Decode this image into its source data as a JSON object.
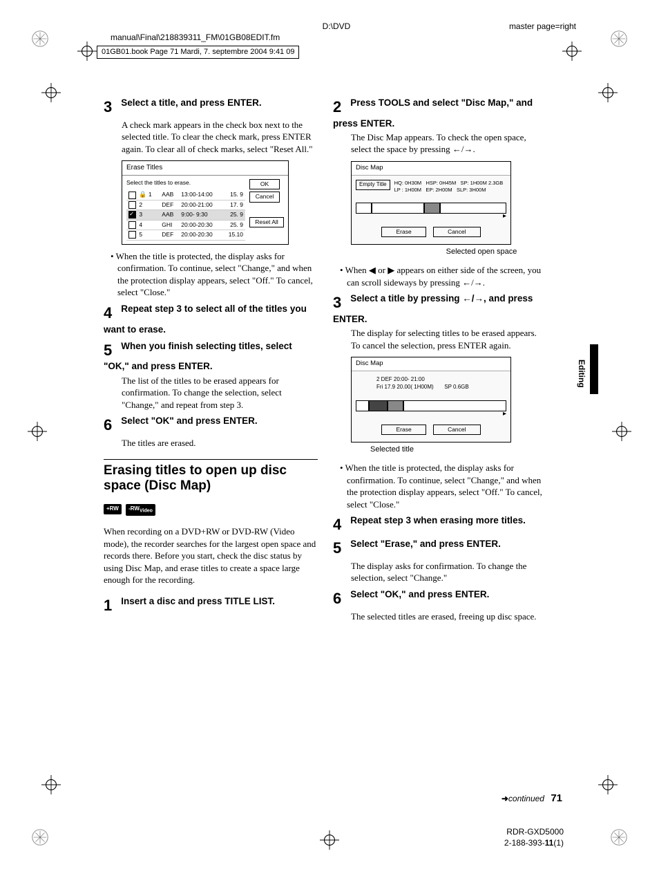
{
  "header": {
    "path1": "D:\\DVD",
    "path2": "manual\\Final\\218839311_FM\\01GB08EDIT.fm",
    "master": "master page=right",
    "book": "01GB01.book  Page 71  Mardi, 7. septembre 2004  9:41 09"
  },
  "left": {
    "s3_head": "Select a title, and press ENTER.",
    "s3_body": "A check mark appears in the check box next to the selected title. To clear the check mark, press ENTER again. To clear all of check marks, select \"Reset All.\"",
    "erase_panel": {
      "title": "Erase Titles",
      "instr": "Select the titles to erase.",
      "btn_ok": "OK",
      "btn_cancel": "Cancel",
      "btn_reset": "Reset All",
      "rows": [
        {
          "n": "1",
          "name": "AAB",
          "time": "13:00-14:00",
          "d": "15. 9",
          "lock": true,
          "checked": false
        },
        {
          "n": "2",
          "name": "DEF",
          "time": "20:00-21:00",
          "d": "17. 9",
          "lock": false,
          "checked": false
        },
        {
          "n": "3",
          "name": "AAB",
          "time": "9:00- 9:30",
          "d": "25. 9",
          "lock": false,
          "checked": true
        },
        {
          "n": "4",
          "name": "GHI",
          "time": "20:00-20:30",
          "d": "25. 9",
          "lock": false,
          "checked": false
        },
        {
          "n": "5",
          "name": "DEF",
          "time": "20:00-20:30",
          "d": "15.10",
          "lock": false,
          "checked": false
        }
      ]
    },
    "s3_note": "When the title is protected, the display asks for confirmation. To continue, select \"Change,\" and when the protection display appears, select \"Off.\" To cancel, select \"Close.\"",
    "s4_head": "Repeat step 3 to select all of the titles you want to erase.",
    "s5_head": "When you finish selecting titles, select \"OK,\" and press ENTER.",
    "s5_body": "The list of the titles to be erased appears for confirmation. To change the selection, select \"Change,\" and repeat from step 3.",
    "s6_head": "Select \"OK\" and press ENTER.",
    "s6_body": "The titles are erased.",
    "section": "Erasing titles to open up disc space (Disc Map)",
    "badges": {
      "a": "+RW",
      "b": "-RW",
      "bvideo": "Video"
    },
    "intro": "When recording on a DVD+RW or DVD-RW (Video mode), the recorder searches for the largest open space and records there. Before you start, check the disc status by using Disc Map, and erase titles to create a space large enough for the recording.",
    "s1_head": "Insert a disc and press TITLE LIST."
  },
  "right": {
    "s2_head": "Press TOOLS and select \"Disc Map,\" and press ENTER.",
    "s2_body": "The Disc Map appears. To check the open space, select the space by pressing ←/→.",
    "dm1": {
      "title": "Disc Map",
      "empty": "Empty Title",
      "l1": "HQ: 0H30M",
      "l2": "LP : 1H00M",
      "l3": "HSP: 0H45M",
      "l4": "EP: 2H00M",
      "l5": "SP: 1H00M",
      "l6": "SLP: 3H00M",
      "size": "2.3GB",
      "erase": "Erase",
      "cancel": "Cancel",
      "cap": "Selected open space"
    },
    "s2_note": "When ◀ or ▶ appears on either side of the screen, you can scroll sideways by pressing ←/→.",
    "s3_head": "Select a title by pressing ←/→, and press ENTER.",
    "s3_body": "The display for selecting titles to be erased appears. To cancel the selection, press ENTER again.",
    "dm2": {
      "title": "Disc Map",
      "l1": "2 DEF  20:00- 21:00",
      "l2": "Fri 17.9 20.00( 1H00M)",
      "l3": "SP   0.6GB",
      "erase": "Erase",
      "cancel": "Cancel",
      "cap": "Selected title"
    },
    "s3_note": "When the title is protected, the display asks for confirmation. To continue, select \"Change,\" and when the protection display appears, select \"Off.\" To cancel, select \"Close.\"",
    "s4_head": "Repeat step 3 when erasing more titles.",
    "s5_head": "Select \"Erase,\" and press ENTER.",
    "s5_body": "The display asks for confirmation. To change the selection, select \"Change.\"",
    "s6_head": "Select \"OK,\" and press ENTER.",
    "s6_body": "The selected titles are erased, freeing up disc space."
  },
  "tab": "Editing",
  "continued": "continued",
  "pagenum": "71",
  "footer": {
    "model": "RDR-GXD5000",
    "code": "2-188-393-11(1)"
  }
}
